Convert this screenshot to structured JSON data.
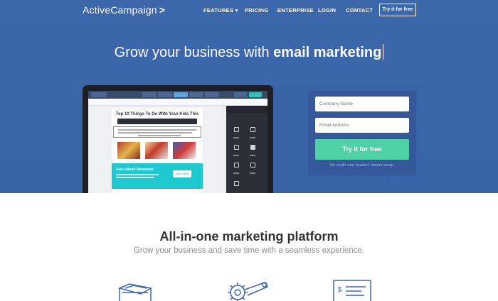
{
  "nav": {
    "logo": "ActiveCampaign",
    "logo_mark": ">",
    "links": [
      "FEATURES",
      "PRICING",
      "ENTERPRISE",
      "LOGIN",
      "CONTACT"
    ],
    "features_chevron": "▾",
    "cta": "Try it for free"
  },
  "hero": {
    "headline_part1": "Grow your business with ",
    "headline_part2": "email marketing",
    "form": {
      "company_placeholder": "Company Name",
      "email_placeholder": "Email Address",
      "submit": "Try it for free",
      "note": "No credit card needed. Instant setup."
    },
    "preview": {
      "doc_title": "Top 10 Things To Do With Your Kids This",
      "promo_title": "Free eBook Download",
      "promo_button": "Get it Now"
    }
  },
  "section2": {
    "title": "All-in-one marketing platform",
    "subtitle": "Grow your business and save time with a seamless experience."
  },
  "colors": {
    "hero_blue": "#3c67ab",
    "cta_green": "#4dd1a5",
    "icon_blue": "#3d67ad"
  },
  "icons": [
    "envelope-stack-icon",
    "gear-automation-icon",
    "invoice-dashboard-icon"
  ]
}
